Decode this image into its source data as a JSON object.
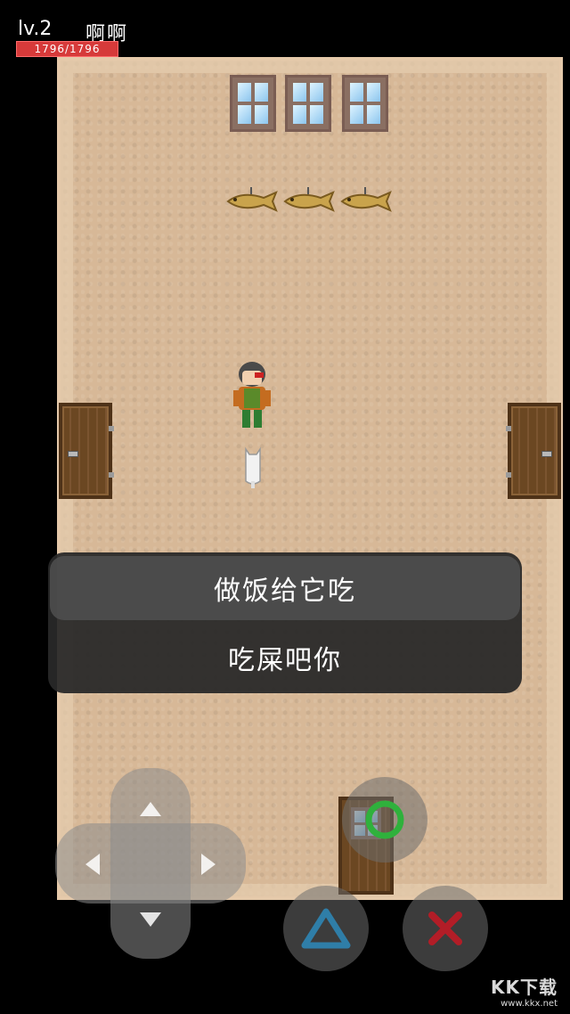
{
  "hud": {
    "level": "lv.2",
    "name": "啊啊",
    "hp": "1796/1796"
  },
  "menu": {
    "options": [
      "做饭给它吃",
      "吃屎吧你"
    ]
  },
  "controls": {
    "dpad": [
      "up",
      "down",
      "left",
      "right"
    ],
    "buttons": [
      "circle",
      "triangle",
      "cross"
    ],
    "colors": {
      "circle": "#2fb13c",
      "triangle": "#2f7ea8",
      "cross": "#b21d27"
    }
  },
  "watermark": {
    "brand": "KK下载",
    "url": "www.kkx.net"
  }
}
